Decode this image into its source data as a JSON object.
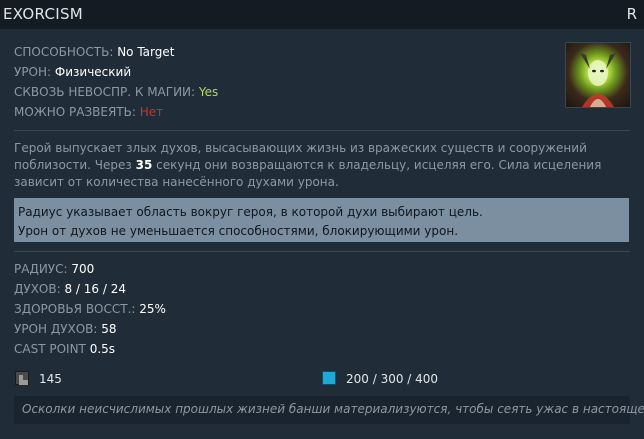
{
  "header": {
    "title": "EXORCISM",
    "hotkey": "R"
  },
  "attributes": [
    {
      "key": "СПОСОБНОСТЬ:",
      "value": "No Target",
      "value_color": "white"
    },
    {
      "key": "УРОН:",
      "value": "Физический",
      "value_color": "white"
    },
    {
      "key": "СКВОЗЬ НЕВОСПР. К МАГИИ:",
      "value": "Yes",
      "value_color": "green"
    },
    {
      "key": "МОЖНО РАЗВЕЯТЬ:",
      "value": "Нет",
      "value_color": "red"
    }
  ],
  "portrait": {
    "icon": "banshee-spirit-portrait"
  },
  "description": {
    "part1": "Герой выпускает злых духов, высасывающих жизнь из вражеских существ и сооружений поблизости. Через ",
    "bold": "35",
    "part2": " секунд они возвращаются к владельцу, исцеляя его. Сила исцеления зависит от количества нанесённого духами урона."
  },
  "note": {
    "line1": "Радиус указывает область вокруг героя, в которой духи выбирают цель.",
    "line2": "Урон от духов не уменьшается способностями, блокирующими урон."
  },
  "stats": [
    {
      "key": "РАДИУС:",
      "value": "700"
    },
    {
      "key": "ДУХОВ:",
      "value": "8 / 16 / 24"
    },
    {
      "key": "ЗДОРОВЬЯ ВОССТ.:",
      "value": "25%"
    },
    {
      "key": "УРОН ДУХОВ:",
      "value": "58"
    },
    {
      "key": "CAST POINT",
      "value": "0.5s"
    }
  ],
  "costs": {
    "cooldown": {
      "icon": "cooldown-icon",
      "value": "145"
    },
    "mana": {
      "icon": "mana-icon",
      "value": "200 / 300 / 400"
    }
  },
  "lore": "Осколки неисчислимых прошлых жизней банши материализуются, чтобы сеять ужас в настоящем.",
  "colors": {
    "green": "#b7d36b",
    "red": "#c8332c",
    "mana": "#20a9d6",
    "note_bg": "#7c8fa0"
  }
}
